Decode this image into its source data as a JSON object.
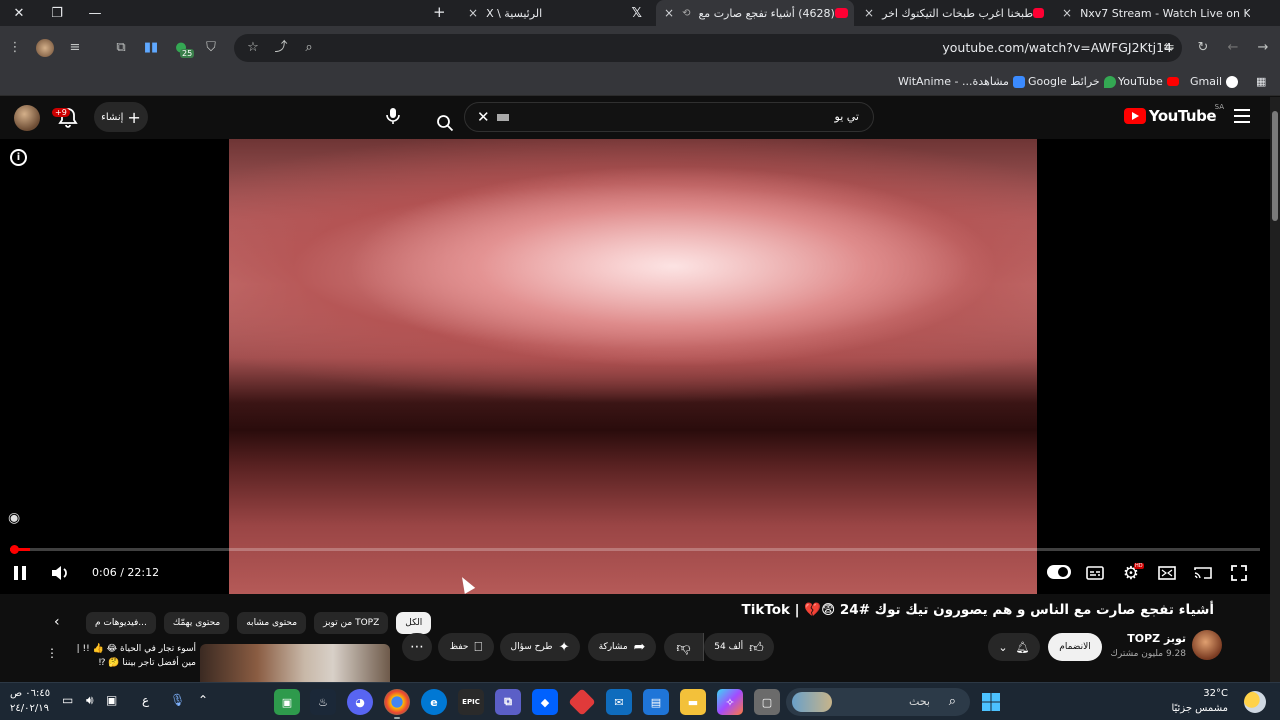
{
  "browser": {
    "tabs": [
      {
        "label": "الرئيسية \\ X",
        "close": "×"
      },
      {
        "label": "(4628) أشياء تفجع صارت مع",
        "close": "×",
        "active": true
      },
      {
        "label": "طبخنا اغرب طبخات التيكتوك اخر",
        "close": "×"
      },
      {
        "label": "Nxv7 Stream - Watch Live on K",
        "close": "×"
      }
    ],
    "new_tab": "+",
    "url": "youtube.com/watch?v=AWFGJ2Ktj14"
  },
  "bookmarks": [
    {
      "label": "Gmail",
      "color": "#ea4335"
    },
    {
      "label": "YouTube",
      "color": "#ff0000"
    },
    {
      "label": "خرائط Google",
      "color": "#34a853"
    },
    {
      "label": "مشاهدة... - WitAnime",
      "color": "#3b8bff"
    }
  ],
  "youtube": {
    "logo_text": "YouTube",
    "region": "SA",
    "search_value": "تي يو",
    "create_label": "إنشاء",
    "notifications_badge": "+9"
  },
  "player": {
    "time": "0:06 / 22:12",
    "progress_fraction": 0.0045
  },
  "video": {
    "title": "أشياء تفجع صارت مع الناس و هم يصورون تيك توك #24 😨💔 | TikTok",
    "channel_name": "توبز TOPZ",
    "subscribers": "9.28 مليون مشترك",
    "join_label": "الانضمام",
    "likes": "54 ألف",
    "share_label": "مشاركة",
    "ask_label": "طرح سؤال",
    "save_label": "حفظ"
  },
  "chips": [
    "فيديوهات م...",
    "محتوى يهمّك",
    "محتوى مشابه",
    "من توبز TOPZ",
    "الكل"
  ],
  "related": {
    "title": "أسوء تجار في الحياة 😂 👍 !! | مين أفضل تاجر بيننا 🤔 ⁉"
  },
  "taskbar": {
    "search_placeholder": "بحث",
    "weather_temp": "32°C",
    "weather_desc": "مشمس جزئيًا",
    "time": "٠٦:٤٥ ص",
    "date": "٢٤/٠٢/١٩",
    "lang": "ع"
  }
}
